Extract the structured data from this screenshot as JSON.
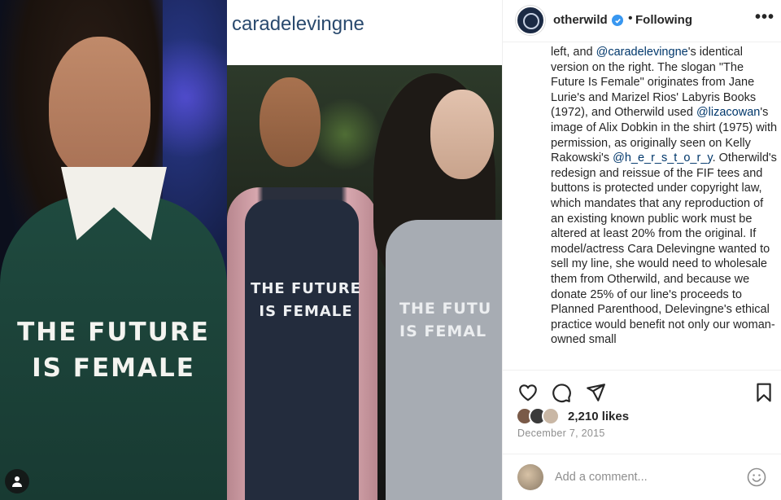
{
  "post": {
    "username": "otherwild",
    "follow_status": "Following",
    "separator": "•",
    "more_label": "•••",
    "photo": {
      "tag_handle": "caradelevingne",
      "slogan_line1": "THE FUTURE",
      "slogan_line2": "IS FEMALE",
      "slogan_mid_line1": "THE FUTURE",
      "slogan_mid_line2": "IS FEMALE",
      "slogan_right_line1": "THE FUTU",
      "slogan_right_line2": "IS FEMAL"
    },
    "caption": {
      "t1": "left, and ",
      "m1": "@caradelevingne",
      "t2": "'s identical version on the right. The slogan \"The Future Is Female\" originates from Jane Lurie's and Marizel Rios' Labyris Books (1972), and Otherwild used ",
      "m2": "@lizacowan",
      "t3": "'s image of Alix Dobkin in the shirt (1975) with permission, as originally seen on Kelly Rakowski's ",
      "m3": "@h_e_r_s_t_o_r_y",
      "t4": ". Otherwild's redesign and reissue of the FIF tees and buttons is protected under copyright law, which mandates that any reproduction of an existing known public work must be altered at least 20% from the original. If model/actress Cara Delevingne wanted to sell my line, she would need to wholesale them from Otherwild, and because we donate 25% of our line's proceeds to Planned Parenthood, Delevingne's ethical practice would benefit not only our woman-owned small"
    },
    "likes": "2,210 likes",
    "date": "December 7, 2015",
    "comment_placeholder": "Add a comment..."
  },
  "icons": {
    "like": "heart-icon",
    "comment": "comment-icon",
    "share": "share-icon",
    "save": "bookmark-icon",
    "emoji": "emoji-icon",
    "verified": "verified-badge-icon",
    "more": "more-options-icon",
    "user_tag": "user-tag-icon"
  },
  "colors": {
    "link": "#00376b",
    "verified": "#3897f0",
    "secondary_text": "#8e8e8e"
  }
}
